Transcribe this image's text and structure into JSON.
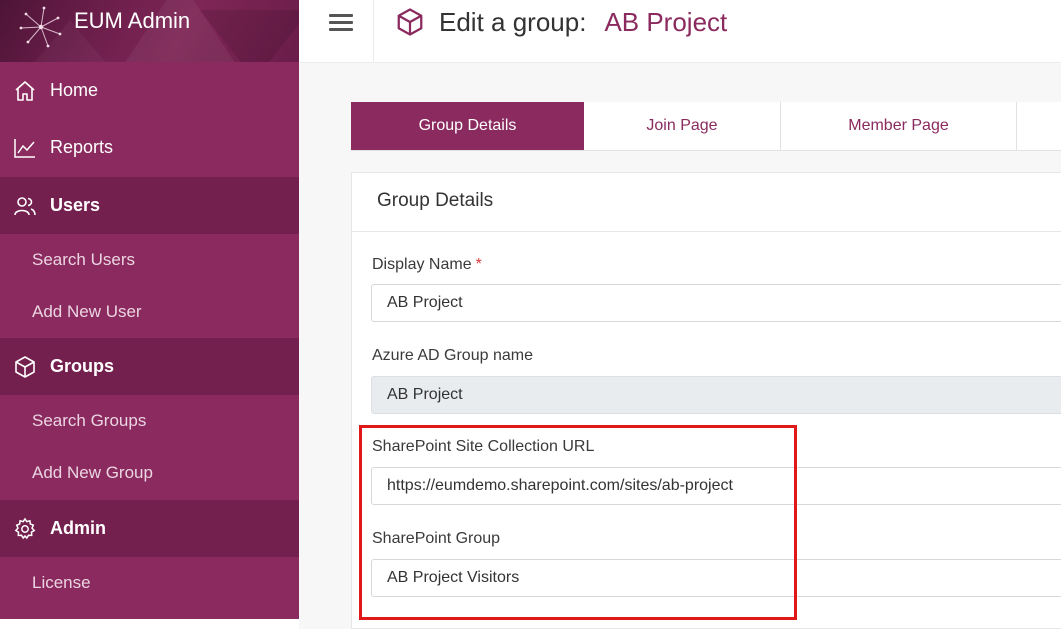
{
  "brand": {
    "title": "EUM Admin"
  },
  "sidebar": {
    "items": [
      {
        "label": "Home",
        "icon": "home-icon"
      },
      {
        "label": "Reports",
        "icon": "chart-line-icon"
      },
      {
        "label": "Users",
        "icon": "users-icon"
      },
      {
        "label": "Search Users"
      },
      {
        "label": "Add New User"
      },
      {
        "label": "Groups",
        "icon": "cube-icon"
      },
      {
        "label": "Search Groups"
      },
      {
        "label": "Add New Group"
      },
      {
        "label": "Admin",
        "icon": "gear-icon"
      },
      {
        "label": "License"
      }
    ]
  },
  "header": {
    "title_prefix": "Edit a group:",
    "group_name": "AB Project"
  },
  "tabs": [
    {
      "label": "Group Details",
      "active": true
    },
    {
      "label": "Join Page"
    },
    {
      "label": "Member Page"
    }
  ],
  "card": {
    "title": "Group Details",
    "fields": {
      "display_name": {
        "label": "Display Name",
        "required_mark": "*",
        "value": "AB Project"
      },
      "azure_group": {
        "label": "Azure AD Group name",
        "value": "AB Project"
      },
      "site_url": {
        "label": "SharePoint Site Collection URL",
        "value": "https://eumdemo.sharepoint.com/sites/ab-project"
      },
      "sp_group": {
        "label": "SharePoint Group",
        "value": "AB Project Visitors"
      }
    }
  },
  "colors": {
    "brand": "#8a2a5e",
    "brand_dark": "#74204f",
    "highlight": "#e01818"
  }
}
